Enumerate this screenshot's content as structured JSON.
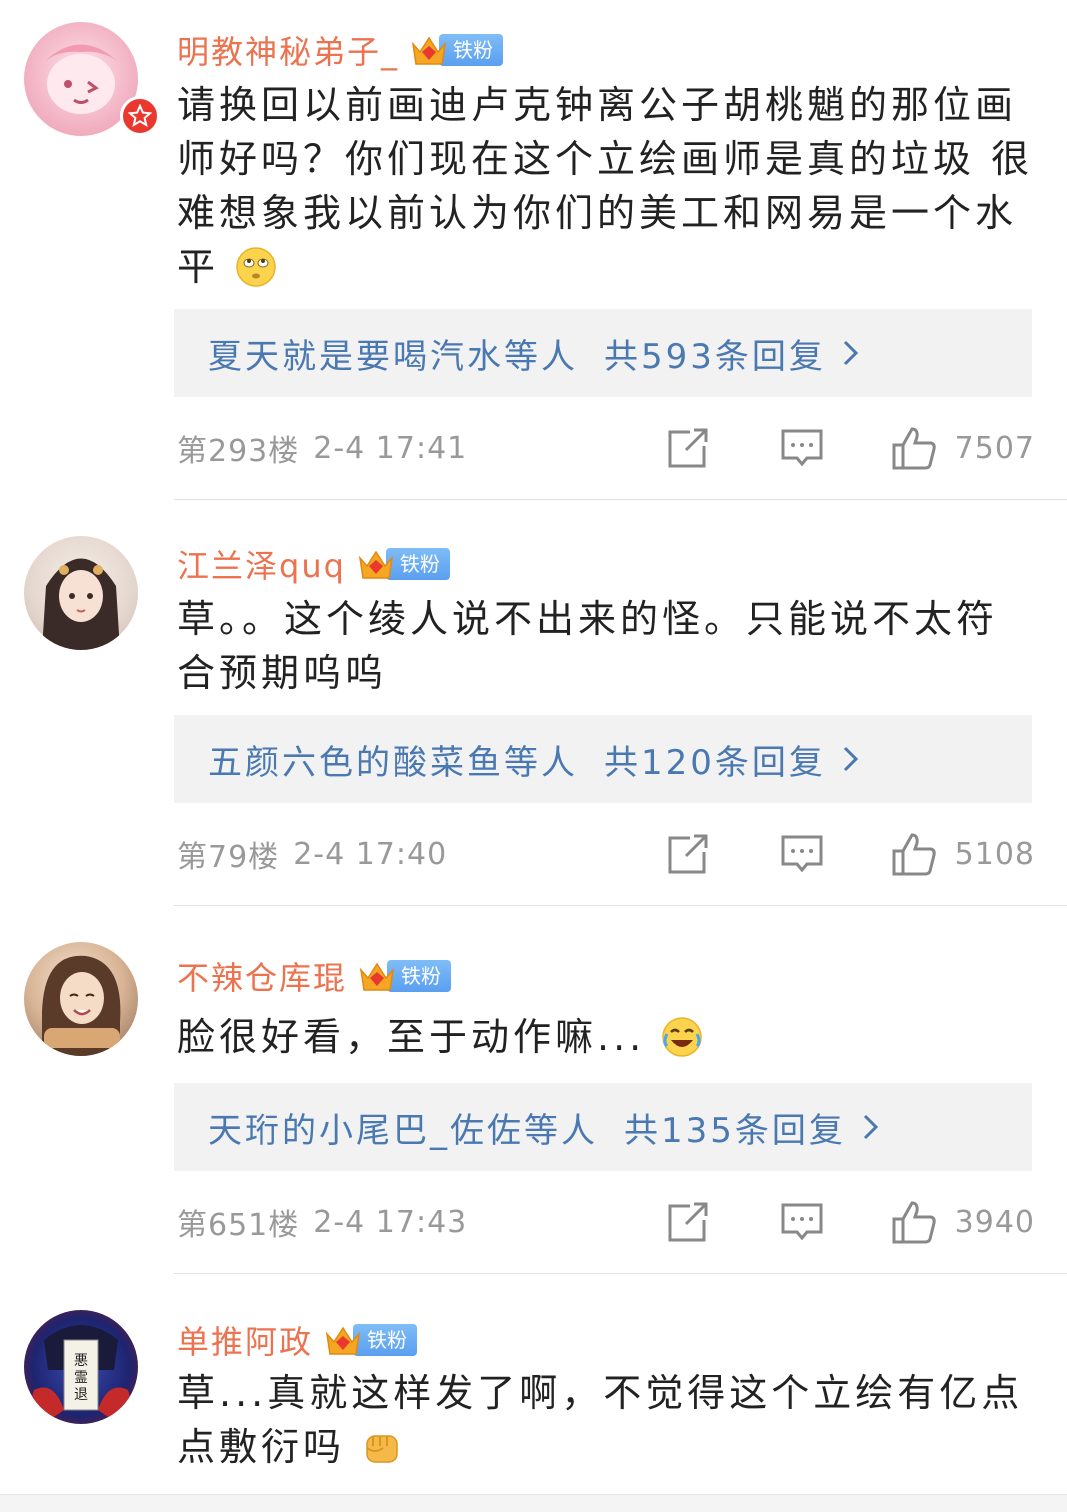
{
  "comments": [
    {
      "username": "明教神秘弟子_",
      "badge_label": "铁粉",
      "badge_level": "7",
      "content": "请换回以前画迪卢克钟离公子胡桃魈的那位画师好吗？你们现在这个立绘画师是真的垃圾 很难想象我以前认为你们的美工和网易是一个水平",
      "emoji": "eye-roll-emoji",
      "replies_from": "夏天就是要喝汽水等人",
      "replies_count": "共593条回复",
      "floor": "第293楼",
      "time": "2-4 17:41",
      "likes": "7507"
    },
    {
      "username": "江兰泽quq",
      "badge_label": "铁粉",
      "badge_level": "1",
      "content": "草。。这个绫人说不出来的怪。只能说不太符合预期呜呜",
      "replies_from": "五颜六色的酸菜鱼等人",
      "replies_count": "共120条回复",
      "floor": "第79楼",
      "time": "2-4 17:40",
      "likes": "5108"
    },
    {
      "username": "不辣仓库琨",
      "badge_label": "铁粉",
      "badge_level": "4",
      "content": "脸很好看，至于动作嘛...",
      "emoji": "laugh-cry-emoji",
      "replies_from": "天珩的小尾巴_佐佐等人",
      "replies_count": "共135条回复",
      "floor": "第651楼",
      "time": "2-4 17:43",
      "likes": "3940"
    },
    {
      "username": "单推阿政",
      "badge_label": "铁粉",
      "badge_level": "3",
      "content": "草...真就这样发了啊，不觉得这个立绘有亿点点敷衍吗",
      "emoji": "fist-emoji"
    }
  ],
  "colors": {
    "username": "#eb7350",
    "reply_link": "#4a78b0",
    "meta": "#999999",
    "badge": "#5a9ff0"
  }
}
